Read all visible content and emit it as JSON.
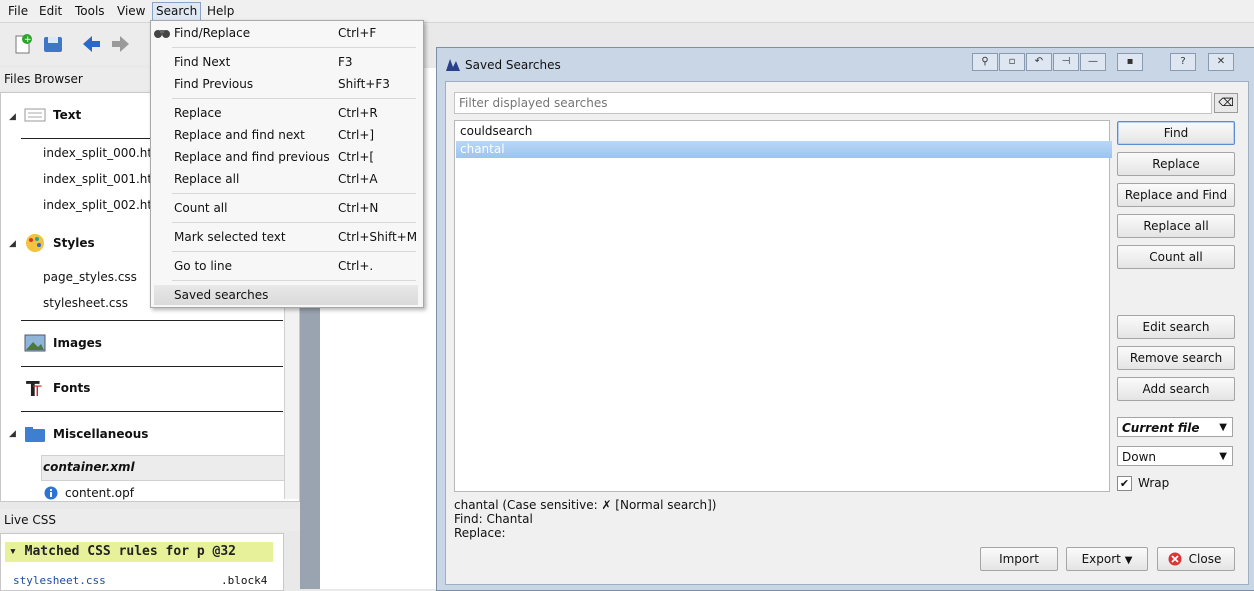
{
  "menubar": {
    "items": [
      "File",
      "Edit",
      "Tools",
      "View",
      "Search",
      "Help"
    ]
  },
  "files_browser": {
    "title": "Files Browser",
    "sections": [
      {
        "label": "Text",
        "files": [
          "index_split_000.htm",
          "index_split_001.htm",
          "index_split_002.htm"
        ]
      },
      {
        "label": "Styles",
        "files": [
          "page_styles.css",
          "stylesheet.css"
        ]
      },
      {
        "label": "Images"
      },
      {
        "label": "Fonts"
      },
      {
        "label": "Miscellaneous",
        "files": [
          "container.xml",
          "content.opf"
        ]
      }
    ]
  },
  "live_css": {
    "title": "Live CSS",
    "matched": "Matched CSS rules for p @32",
    "file": "stylesheet.css",
    "selector": ".block4"
  },
  "search_menu": {
    "items": [
      {
        "label": "Find/Replace",
        "shortcut": "Ctrl+F"
      },
      {
        "label": "Find Next",
        "shortcut": "F3"
      },
      {
        "label": "Find Previous",
        "shortcut": "Shift+F3"
      },
      {
        "label": "Replace",
        "shortcut": "Ctrl+R"
      },
      {
        "label": "Replace and find next",
        "shortcut": "Ctrl+]"
      },
      {
        "label": "Replace and find previous",
        "shortcut": "Ctrl+["
      },
      {
        "label": "Replace all",
        "shortcut": "Ctrl+A"
      },
      {
        "label": "Count all",
        "shortcut": "Ctrl+N"
      },
      {
        "label": "Mark selected text",
        "shortcut": "Ctrl+Shift+M"
      },
      {
        "label": "Go to line",
        "shortcut": "Ctrl+."
      },
      {
        "label": "Saved searches",
        "shortcut": ""
      }
    ]
  },
  "dialog": {
    "title": "Saved Searches",
    "filter_placeholder": "Filter displayed searches",
    "searches": [
      "couldsearch",
      "chantal"
    ],
    "buttons": {
      "find": "Find",
      "replace": "Replace",
      "replace_and_find": "Replace and Find",
      "replace_all": "Replace all",
      "count_all": "Count all",
      "edit": "Edit search",
      "remove": "Remove search",
      "add": "Add search",
      "import": "Import",
      "export": "Export",
      "close": "Close"
    },
    "where": "Current file",
    "direction": "Down",
    "wrap_label": "Wrap",
    "wrap_checked": true,
    "details": {
      "summary": "chantal (Case sensitive: ✗ [Normal search])",
      "find": "Find: Chantal",
      "replace": "Replace:"
    }
  },
  "colors": {
    "selection": "#9cc4ef",
    "matched_bg": "#e6f19a",
    "dialog_frame": "#c9d6e6"
  }
}
